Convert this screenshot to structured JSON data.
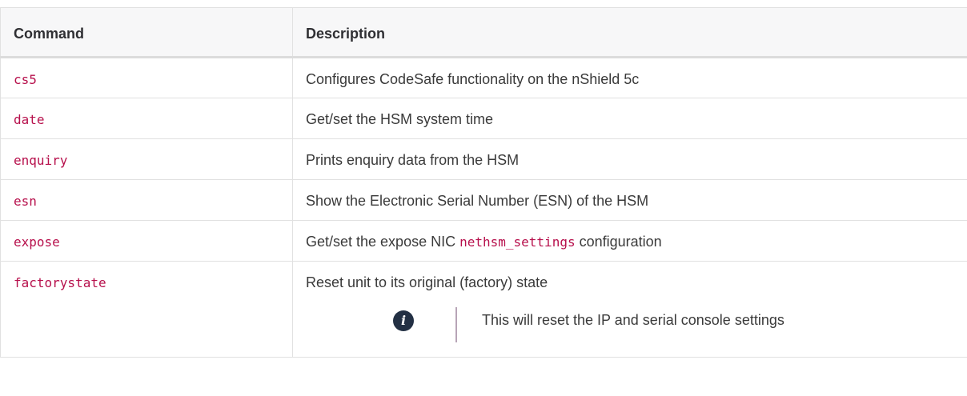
{
  "table": {
    "headers": [
      "Command",
      "Description"
    ],
    "rows": [
      {
        "command": "cs5",
        "description": "Configures CodeSafe functionality on the nShield 5c"
      },
      {
        "command": "date",
        "description": "Get/set the HSM system time"
      },
      {
        "command": "enquiry",
        "description": "Prints enquiry data from the HSM"
      },
      {
        "command": "esn",
        "description": "Show the Electronic Serial Number (ESN) of the HSM"
      },
      {
        "command": "expose",
        "description_prefix": "Get/set the expose NIC ",
        "description_code": "nethsm_settings",
        "description_suffix": " configuration"
      },
      {
        "command": "factorystate",
        "description": "Reset unit to its original (factory) state",
        "note": "This will reset the IP and serial console settings"
      }
    ]
  },
  "colors": {
    "command_text": "#b7104c",
    "header_bg": "#f7f7f8",
    "border": "#e1e1e1",
    "info_icon_bg": "#233044",
    "note_bar": "#b7a4b6"
  },
  "icons": {
    "note_icon": "info-icon"
  }
}
